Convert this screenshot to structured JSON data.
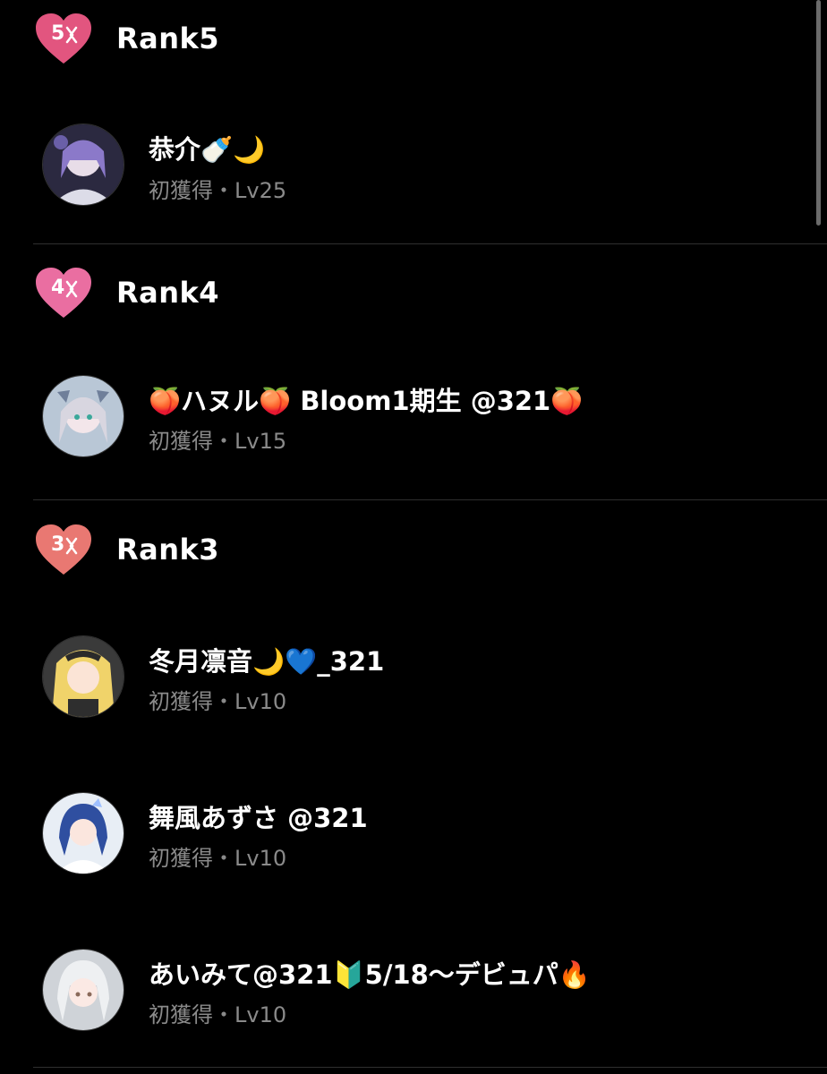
{
  "colors": {
    "background": "#000000",
    "rank5_heart": "#e2557f",
    "rank4_heart": "#ea6ea1",
    "rank3_heart": "#e97872",
    "meta_text": "#8a8a8a"
  },
  "sections": [
    {
      "rank_number": "5",
      "rank_label": "Rank5",
      "users": [
        {
          "name": "恭介🍼🌙",
          "meta": "初獲得・Lv25",
          "avatar": "avatar-purple-hair"
        }
      ]
    },
    {
      "rank_number": "4",
      "rank_label": "Rank4",
      "users": [
        {
          "name": "🍑ハヌル🍑 Bloom1期生 @321🍑",
          "meta": "初獲得・Lv15",
          "avatar": "avatar-silver-catgirl"
        }
      ]
    },
    {
      "rank_number": "3",
      "rank_label": "Rank3",
      "users": [
        {
          "name": "冬月凛音🌙💙_321",
          "meta": "初獲得・Lv10",
          "avatar": "avatar-blonde"
        },
        {
          "name": "舞風あずさ @321",
          "meta": "初獲得・Lv10",
          "avatar": "avatar-blue-hair"
        },
        {
          "name": "あいみて@321🔰5/18〜デビュパ🔥",
          "meta": "初獲得・Lv10",
          "avatar": "avatar-white-hair"
        }
      ]
    }
  ]
}
